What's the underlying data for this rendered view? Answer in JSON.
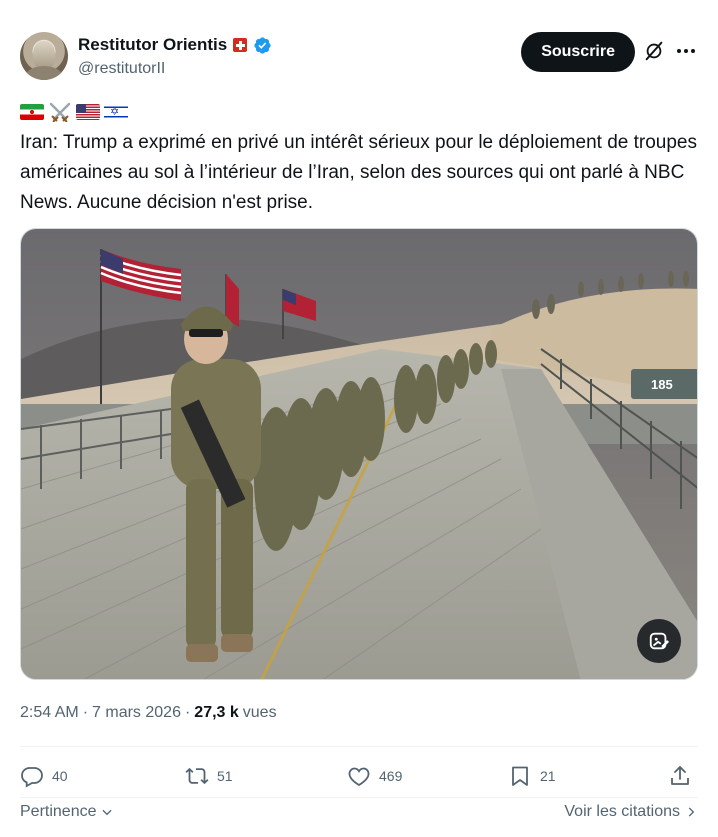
{
  "author": {
    "display_name": "Restitutor Orientis",
    "handle": "@restitutorII"
  },
  "header": {
    "subscribe_label": "Souscrire"
  },
  "icons": {
    "avatar": "avatar-image",
    "country_flag": "swiss-flag-icon",
    "verified": "verified-badge-icon",
    "grok": "grok-icon",
    "more": "more-icon",
    "flags_line": [
      "iran-flag-icon",
      "crossed-swords-icon",
      "us-flag-icon",
      "israel-flag-icon"
    ],
    "media_action": "image-edit-icon"
  },
  "tweet": {
    "text": "Iran: Trump a exprimé en privé un intérêt sérieux pour le déploiement de troupes américaines au sol à l’intérieur de l’Iran, selon des sources qui ont parlé à NBC News. Aucune décision n'est prise."
  },
  "media": {
    "boat_number": "185"
  },
  "meta": {
    "time": "2:54 AM",
    "separator1": "·",
    "date": "7 mars 2026",
    "separator2": "·",
    "views_count": "27,3 k",
    "views_label": "vues"
  },
  "actions": {
    "replies": "40",
    "reposts": "51",
    "likes": "469",
    "bookmarks": "21"
  },
  "footer": {
    "sort_label": "Pertinence",
    "quotes_label": "Voir les citations"
  },
  "colors": {
    "text": "#0f1419",
    "secondary": "#536471",
    "verified": "#1d9bf0",
    "button_bg": "#0f1419"
  }
}
